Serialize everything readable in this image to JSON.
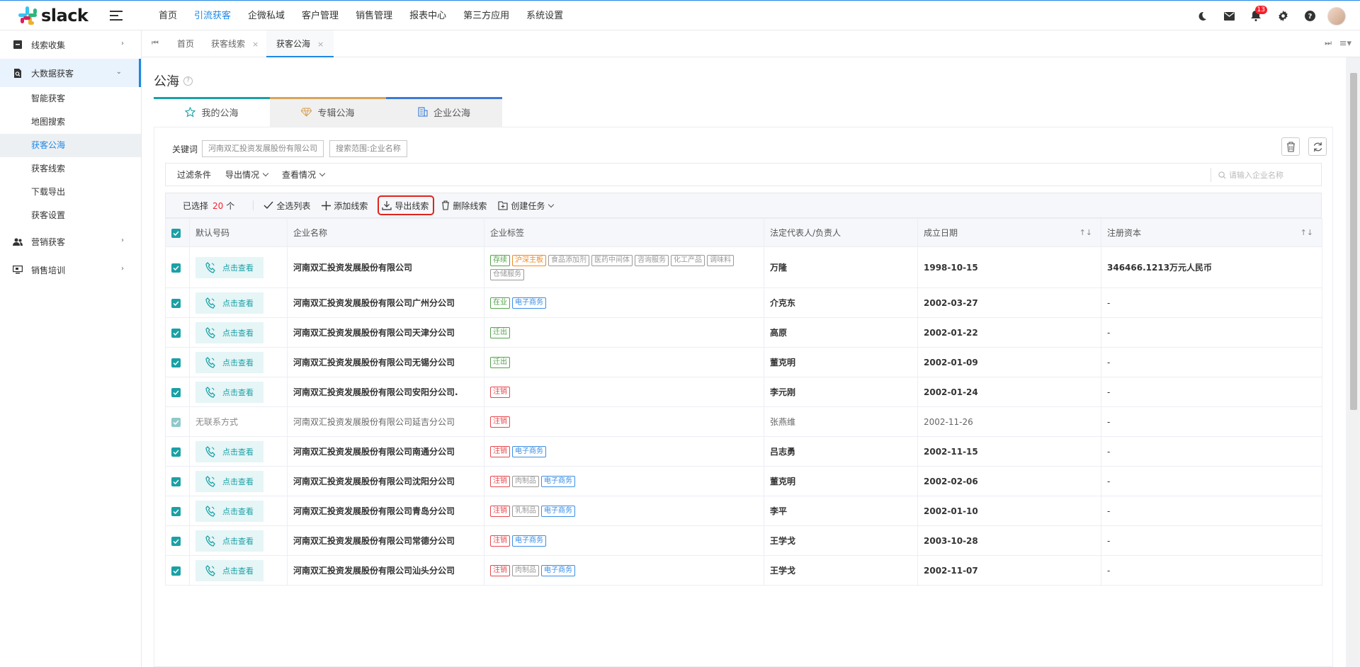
{
  "app": {
    "logo_text": "slack"
  },
  "topnav": {
    "items": [
      {
        "label": "首页",
        "active": false
      },
      {
        "label": "引流获客",
        "active": true
      },
      {
        "label": "企微私域",
        "active": false
      },
      {
        "label": "客户管理",
        "active": false
      },
      {
        "label": "销售管理",
        "active": false
      },
      {
        "label": "报表中心",
        "active": false
      },
      {
        "label": "第三方应用",
        "active": false
      },
      {
        "label": "系统设置",
        "active": false
      }
    ],
    "notification_count": "13"
  },
  "sidebar": {
    "group1": "线索收集",
    "group2": "大数据获客",
    "subs": [
      "智能获客",
      "地图搜索",
      "获客公海",
      "获客线索",
      "下载导出",
      "获客设置"
    ],
    "group3": "营销获客",
    "group4": "销售培训"
  },
  "tabs": {
    "items": [
      "首页",
      "获客线索",
      "获客公海"
    ]
  },
  "page": {
    "title": "公海",
    "help": "?"
  },
  "sea_tabs": {
    "mine": "我的公海",
    "special": "专辑公海",
    "enterprise": "企业公海"
  },
  "search": {
    "label": "关键词",
    "chip1": "河南双汇投资发展股份有限公司",
    "chip2": "搜索范围:企业名称"
  },
  "filters": {
    "f1": "过滤条件",
    "f2": "导出情况",
    "f3": "查看情况",
    "search_placeholder": "请输入企业名称"
  },
  "actions": {
    "selected_prefix": "已选择",
    "selected_count": "20",
    "selected_unit": "个",
    "select_all": "全选列表",
    "add": "添加线索",
    "export": "导出线索",
    "delete": "删除线索",
    "create": "创建任务"
  },
  "table": {
    "headers": {
      "phone": "默认号码",
      "company": "企业名称",
      "tags": "企业标签",
      "legal": "法定代表人/负责人",
      "date": "成立日期",
      "capital": "注册资本"
    },
    "view_label": "点击查看",
    "no_contact_label": "无联系方式",
    "rows": [
      {
        "contact": true,
        "company": "河南双汇投资发展股份有限公司",
        "tags": [
          {
            "t": "存续",
            "c": "green"
          },
          {
            "t": "沪深主板",
            "c": "orange"
          },
          {
            "t": "食品添加剂",
            "c": "gray"
          },
          {
            "t": "医药中间体",
            "c": "gray"
          },
          {
            "t": "咨询服务",
            "c": "gray"
          },
          {
            "t": "化工产品",
            "c": "gray"
          },
          {
            "t": "调味料",
            "c": "gray"
          },
          {
            "t": "仓储服务",
            "c": "gray"
          }
        ],
        "legal": "万隆",
        "date": "1998-10-15",
        "capital": "346466.1213万元人民币"
      },
      {
        "contact": true,
        "company": "河南双汇投资发展股份有限公司广州分公司",
        "tags": [
          {
            "t": "在业",
            "c": "green"
          },
          {
            "t": "电子商务",
            "c": "blue"
          }
        ],
        "legal": "介克东",
        "date": "2002-03-27",
        "capital": "-"
      },
      {
        "contact": true,
        "company": "河南双汇投资发展股份有限公司天津分公司",
        "tags": [
          {
            "t": "迁出",
            "c": "green"
          }
        ],
        "legal": "高原",
        "date": "2002-01-22",
        "capital": "-"
      },
      {
        "contact": true,
        "company": "河南双汇投资发展股份有限公司无锡分公司",
        "tags": [
          {
            "t": "迁出",
            "c": "green"
          }
        ],
        "legal": "董克明",
        "date": "2002-01-09",
        "capital": "-"
      },
      {
        "contact": true,
        "company": "河南双汇投资发展股份有限公司安阳分公司.",
        "tags": [
          {
            "t": "注销",
            "c": "red"
          }
        ],
        "legal": "李元刚",
        "date": "2002-01-24",
        "capital": "-"
      },
      {
        "contact": false,
        "company": "河南双汇投资发展股份有限公司延吉分公司",
        "tags": [
          {
            "t": "注销",
            "c": "red"
          }
        ],
        "legal": "张燕维",
        "date": "2002-11-26",
        "capital": "-"
      },
      {
        "contact": true,
        "company": "河南双汇投资发展股份有限公司南通分公司",
        "tags": [
          {
            "t": "注销",
            "c": "red"
          },
          {
            "t": "电子商务",
            "c": "blue"
          }
        ],
        "legal": "吕志勇",
        "date": "2002-11-15",
        "capital": "-"
      },
      {
        "contact": true,
        "company": "河南双汇投资发展股份有限公司沈阳分公司",
        "tags": [
          {
            "t": "注销",
            "c": "red"
          },
          {
            "t": "肉制品",
            "c": "gray"
          },
          {
            "t": "电子商务",
            "c": "blue"
          }
        ],
        "legal": "董克明",
        "date": "2002-02-06",
        "capital": "-"
      },
      {
        "contact": true,
        "company": "河南双汇投资发展股份有限公司青岛分公司",
        "tags": [
          {
            "t": "注销",
            "c": "red"
          },
          {
            "t": "乳制品",
            "c": "gray"
          },
          {
            "t": "电子商务",
            "c": "blue"
          }
        ],
        "legal": "李平",
        "date": "2002-01-10",
        "capital": "-"
      },
      {
        "contact": true,
        "company": "河南双汇投资发展股份有限公司常德分公司",
        "tags": [
          {
            "t": "注销",
            "c": "red"
          },
          {
            "t": "电子商务",
            "c": "blue"
          }
        ],
        "legal": "王学戈",
        "date": "2003-10-28",
        "capital": "-"
      },
      {
        "contact": true,
        "company": "河南双汇投资发展股份有限公司汕头分公司",
        "tags": [
          {
            "t": "注销",
            "c": "red"
          },
          {
            "t": "肉制品",
            "c": "gray"
          },
          {
            "t": "电子商务",
            "c": "blue"
          }
        ],
        "legal": "王学戈",
        "date": "2002-11-07",
        "capital": "-"
      }
    ]
  },
  "colors": {
    "primary": "#1e88e5",
    "teal": "#1aa1a6",
    "highlight": "#e0241f",
    "tag_green": "#52a34a",
    "tag_orange": "#f08a24",
    "tag_red": "#e5484d",
    "tag_blue": "#3a8ee6",
    "tag_gray": "#999999"
  }
}
